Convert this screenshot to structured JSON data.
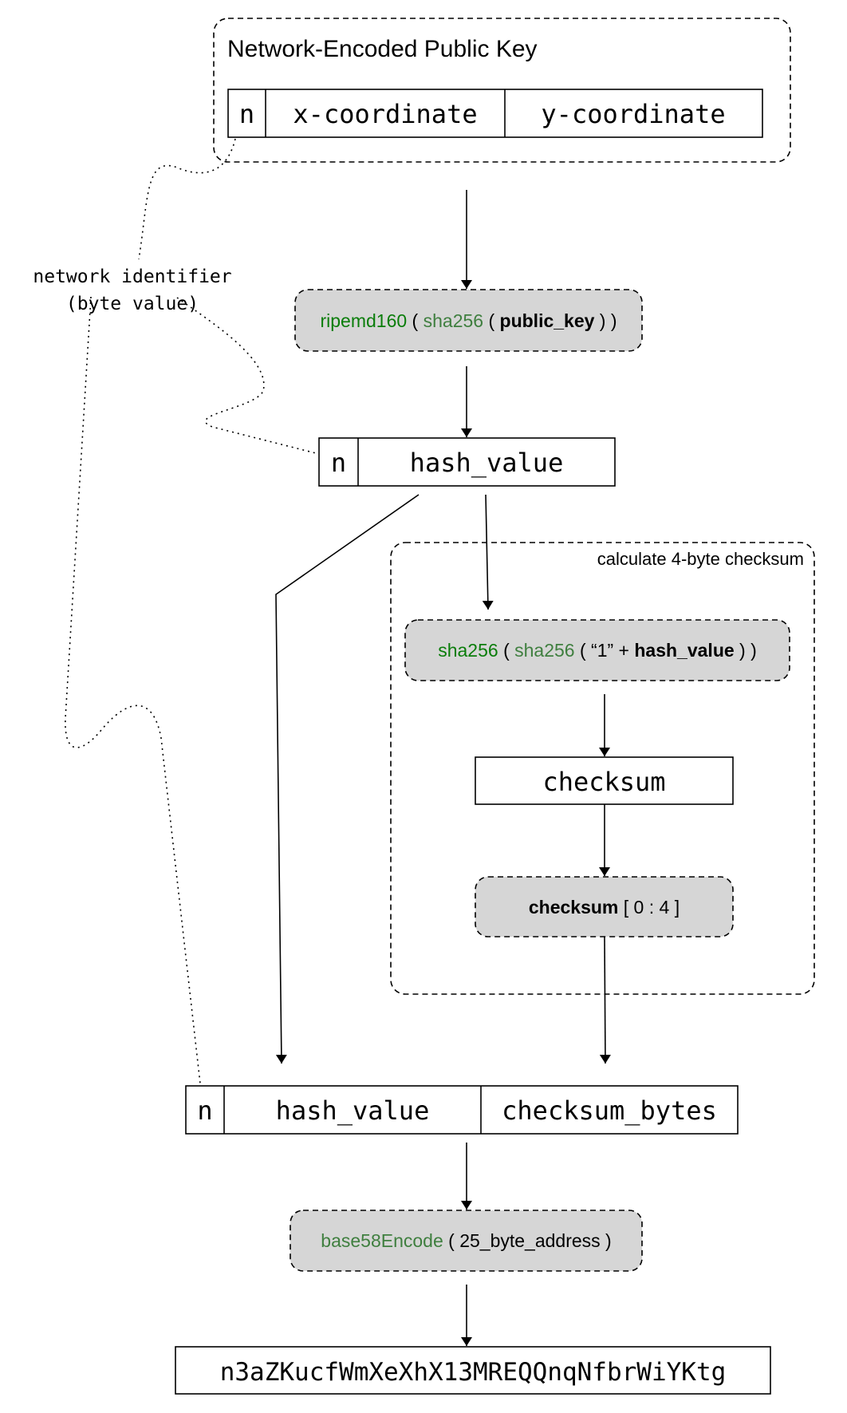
{
  "colors": {
    "function_primary": "#0a7d0a",
    "function_secondary": "#3f7f3f",
    "node_fill": "#d6d6d6"
  },
  "public_key_group": {
    "title": "Network-Encoded Public Key",
    "fields": [
      "n",
      "x-coordinate",
      "y-coordinate"
    ]
  },
  "network_identifier": {
    "line1": "network identifier",
    "line2": "(byte value)"
  },
  "step_ripemd": {
    "fn1": "ripemd160",
    "p1": " ( ",
    "fn2": "sha256",
    "p2": " ( ",
    "arg": "public_key",
    "p3": " ) )"
  },
  "hashed": {
    "fields": [
      "n",
      "hash_value"
    ]
  },
  "checksum_group": {
    "title": "calculate 4-byte checksum",
    "step_sha": {
      "fn1": "sha256",
      "p1": " ( ",
      "fn2": "sha256",
      "p2": " ( “1” + ",
      "arg": "hash_value",
      "p3": " ) )"
    },
    "checksum": "checksum",
    "slice": {
      "arg": "checksum",
      "rest": " [ 0 : 4 ]"
    }
  },
  "address_bytes": {
    "fields": [
      "n",
      "hash_value",
      "checksum_bytes"
    ]
  },
  "step_base58": {
    "fn": "base58Encode",
    "rest": " ( 25_byte_address )"
  },
  "result": "n3aZKucfWmXeXhX13MREQQnqNfbrWiYKtg"
}
